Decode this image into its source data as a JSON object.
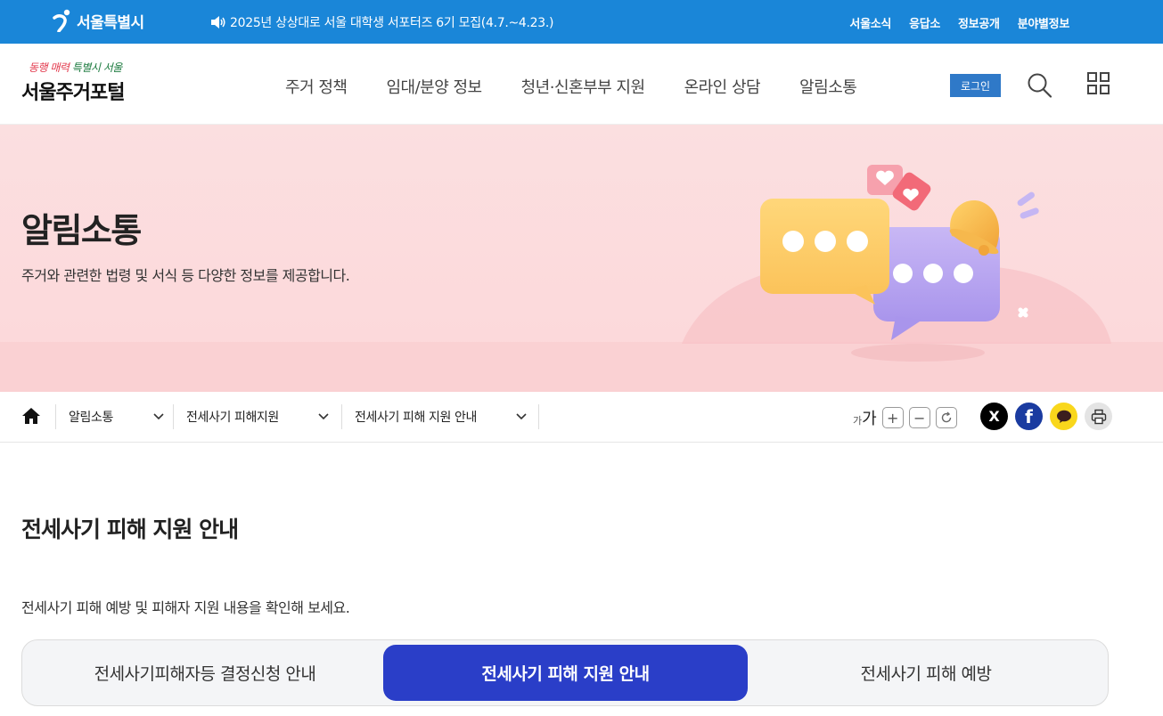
{
  "topbar": {
    "seoul_label": "서울특별시",
    "notice": "2025년 상상대로 서울 대학생 서포터즈 6기 모집(4.7.~4.23.)",
    "utils": [
      "서울소식",
      "응답소",
      "정보공개",
      "분야별정보"
    ]
  },
  "header": {
    "slogan_a": "동행 매력",
    "slogan_b": " 특별시 서울",
    "portal_name": "서울주거포털",
    "gnb": [
      "주거 정책",
      "임대/분양 정보",
      "청년·신혼부부 지원",
      "온라인 상담",
      "알림소통"
    ],
    "login": "로그인"
  },
  "hero": {
    "title": "알림소통",
    "desc": "주거와 관련한 법령 및 서식 등 다양한 정보를 제공합니다."
  },
  "breadcrumb": {
    "items": [
      "알림소통",
      "전세사기 피해지원",
      "전세사기 피해 지원 안내"
    ]
  },
  "font_control": {
    "small": "가",
    "large": "가",
    "plus": "+",
    "minus": "−"
  },
  "sns": {
    "x": "X",
    "facebook": "f"
  },
  "content": {
    "title": "전세사기 피해 지원 안내",
    "desc": "전세사기 피해 예방 및 피해자 지원 내용을 확인해 보세요.",
    "tabs": [
      "전세사기피해자등 결정신청 안내",
      "전세사기 피해 지원 안내",
      "전세사기 피해 예방"
    ],
    "active_tab": 1
  },
  "colors": {
    "topbar": "#1a86d8",
    "active_tab": "#2a3ec8",
    "hero_bg": "#fbdfe0",
    "login": "#2f79c8"
  }
}
